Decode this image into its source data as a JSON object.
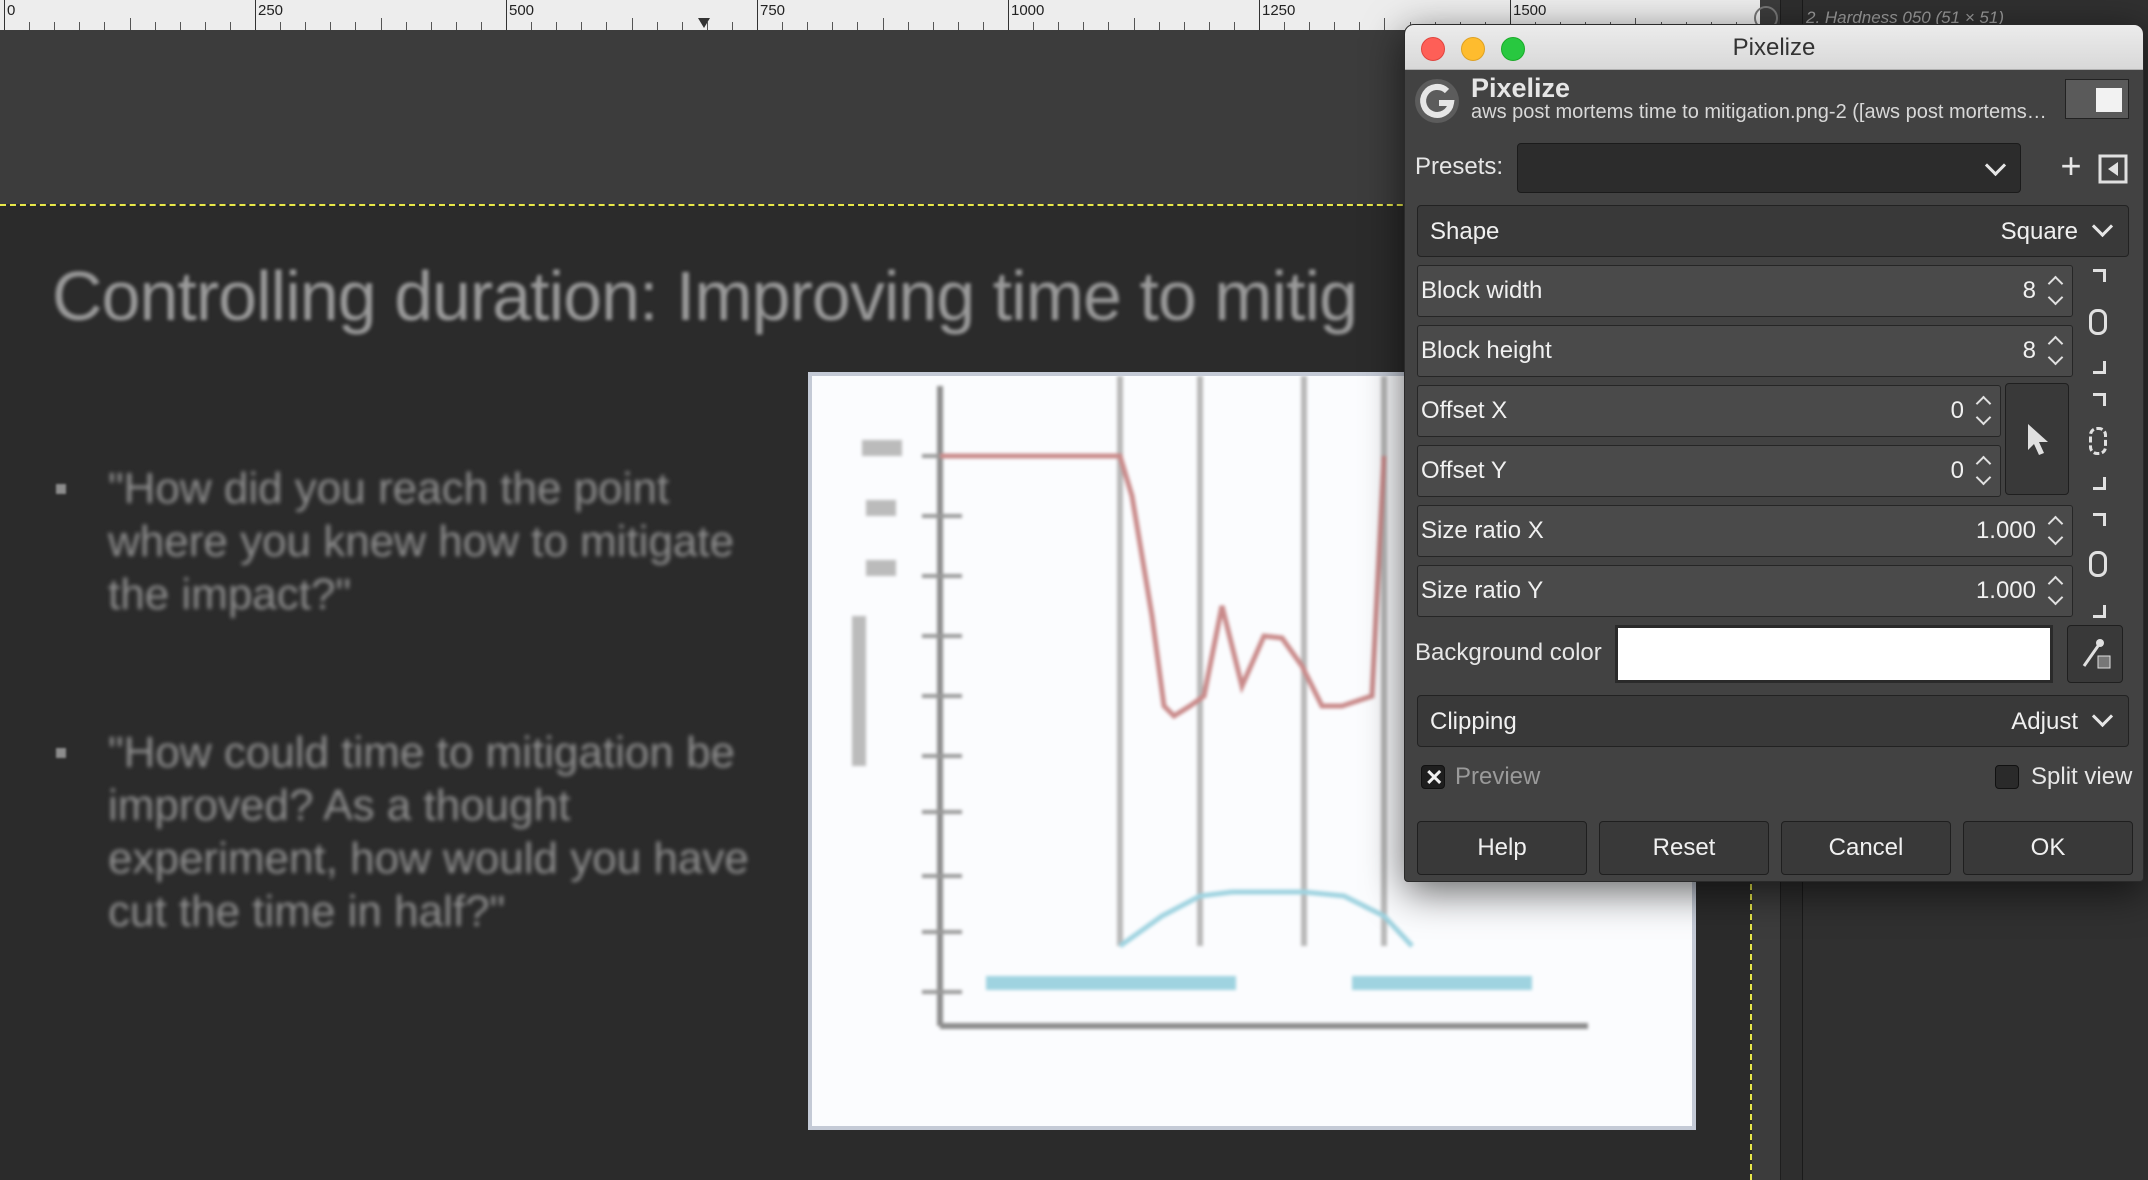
{
  "ruler": {
    "labels": [
      "0",
      "250",
      "500",
      "750",
      "1000",
      "1250",
      "1500"
    ]
  },
  "right_panel": {
    "brush_label": "2. Hardness 050 (51 × 51)"
  },
  "slide": {
    "title": "Controlling duration: Improving time to mitig",
    "bullets": [
      "\"How did you reach the point where you knew how to mitigate the impact?\"",
      "\"How could time to mitigation be improved? As a thought experiment, how would you have cut the time in half?\""
    ]
  },
  "dialog": {
    "window_title": "Pixelize",
    "header_title": "Pixelize",
    "header_subtitle": "aws post mortems time to mitigation.png-2 ([aws post mortems…",
    "presets_label": "Presets:",
    "presets_value": "",
    "shape": {
      "label": "Shape",
      "value": "Square"
    },
    "block_width": {
      "label": "Block width",
      "value": "8"
    },
    "block_height": {
      "label": "Block height",
      "value": "8"
    },
    "offset_x": {
      "label": "Offset X",
      "value": "0"
    },
    "offset_y": {
      "label": "Offset Y",
      "value": "0"
    },
    "size_ratio_x": {
      "label": "Size ratio X",
      "value": "1.000"
    },
    "size_ratio_y": {
      "label": "Size ratio Y",
      "value": "1.000"
    },
    "background_color": {
      "label": "Background color",
      "value": "#ffffff"
    },
    "clipping": {
      "label": "Clipping",
      "value": "Adjust"
    },
    "preview": {
      "label": "Preview",
      "checked": true
    },
    "split_view": {
      "label": "Split view",
      "checked": false
    },
    "buttons": {
      "help": "Help",
      "reset": "Reset",
      "cancel": "Cancel",
      "ok": "OK"
    }
  }
}
